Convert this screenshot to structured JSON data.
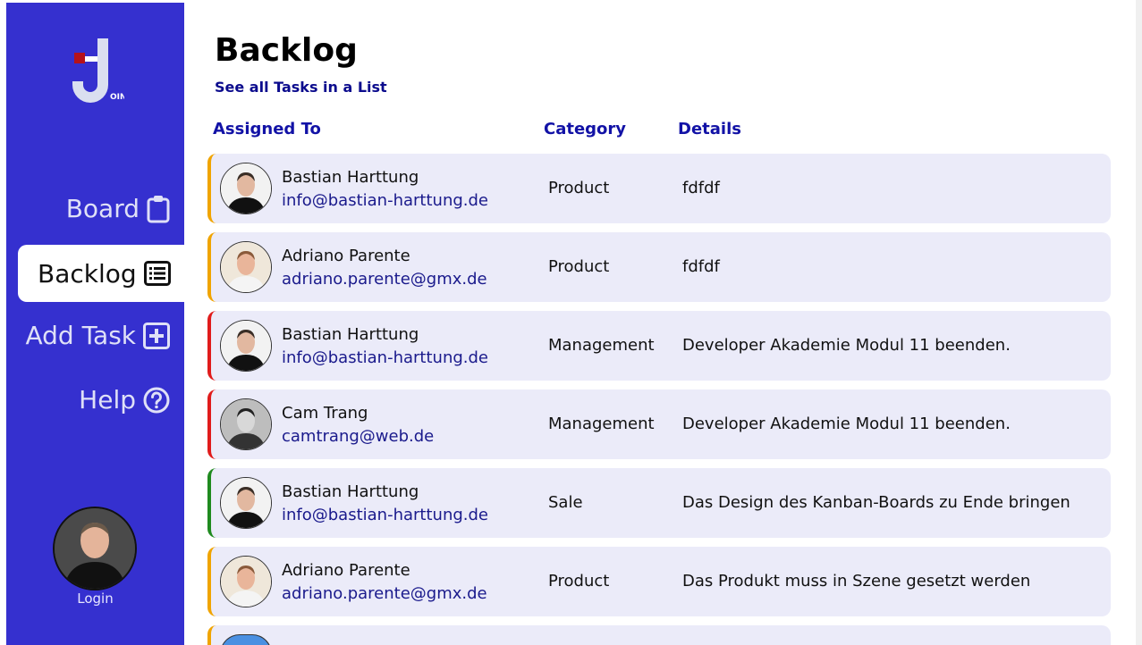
{
  "brand": {
    "logo_suffix": "OIN"
  },
  "nav": [
    {
      "label": "Board",
      "icon": "clipboard-icon",
      "active": false
    },
    {
      "label": "Backlog",
      "icon": "list-icon",
      "active": true
    },
    {
      "label": "Add Task",
      "icon": "plus-square-icon",
      "active": false
    },
    {
      "label": "Help",
      "icon": "question-circle-icon",
      "active": false
    }
  ],
  "user": {
    "login_label": "Login"
  },
  "page": {
    "title": "Backlog",
    "list_link": "See all Tasks in a List"
  },
  "columns": {
    "assigned": "Assigned To",
    "category": "Category",
    "details": "Details"
  },
  "colors": {
    "sidebar": "#3530cf",
    "accent_link": "#1212a6",
    "row_bg": "#ebebf9",
    "orange": "#f0a400",
    "red": "#e01b1b",
    "green": "#1f8a1f"
  },
  "tasks": [
    {
      "name": "Bastian Harttung",
      "email": "info@bastian-harttung.de",
      "category": "Product",
      "details": "fdfdf",
      "priority_color": "#f0a400"
    },
    {
      "name": "Adriano Parente",
      "email": "adriano.parente@gmx.de",
      "category": "Product",
      "details": "fdfdf",
      "priority_color": "#f0a400"
    },
    {
      "name": "Bastian Harttung",
      "email": "info@bastian-harttung.de",
      "category": "Management",
      "details": "Developer Akademie Modul 11 beenden.",
      "priority_color": "#e01b1b"
    },
    {
      "name": "Cam Trang",
      "email": "camtrang@web.de",
      "category": "Management",
      "details": "Developer Akademie Modul 11 beenden.",
      "priority_color": "#e01b1b"
    },
    {
      "name": "Bastian Harttung",
      "email": "info@bastian-harttung.de",
      "category": "Sale",
      "details": "Das Design des Kanban-Boards zu Ende bringen",
      "priority_color": "#1f8a1f"
    },
    {
      "name": "Adriano Parente",
      "email": "adriano.parente@gmx.de",
      "category": "Product",
      "details": "Das Produkt muss in Szene gesetzt werden",
      "priority_color": "#f0a400"
    }
  ]
}
